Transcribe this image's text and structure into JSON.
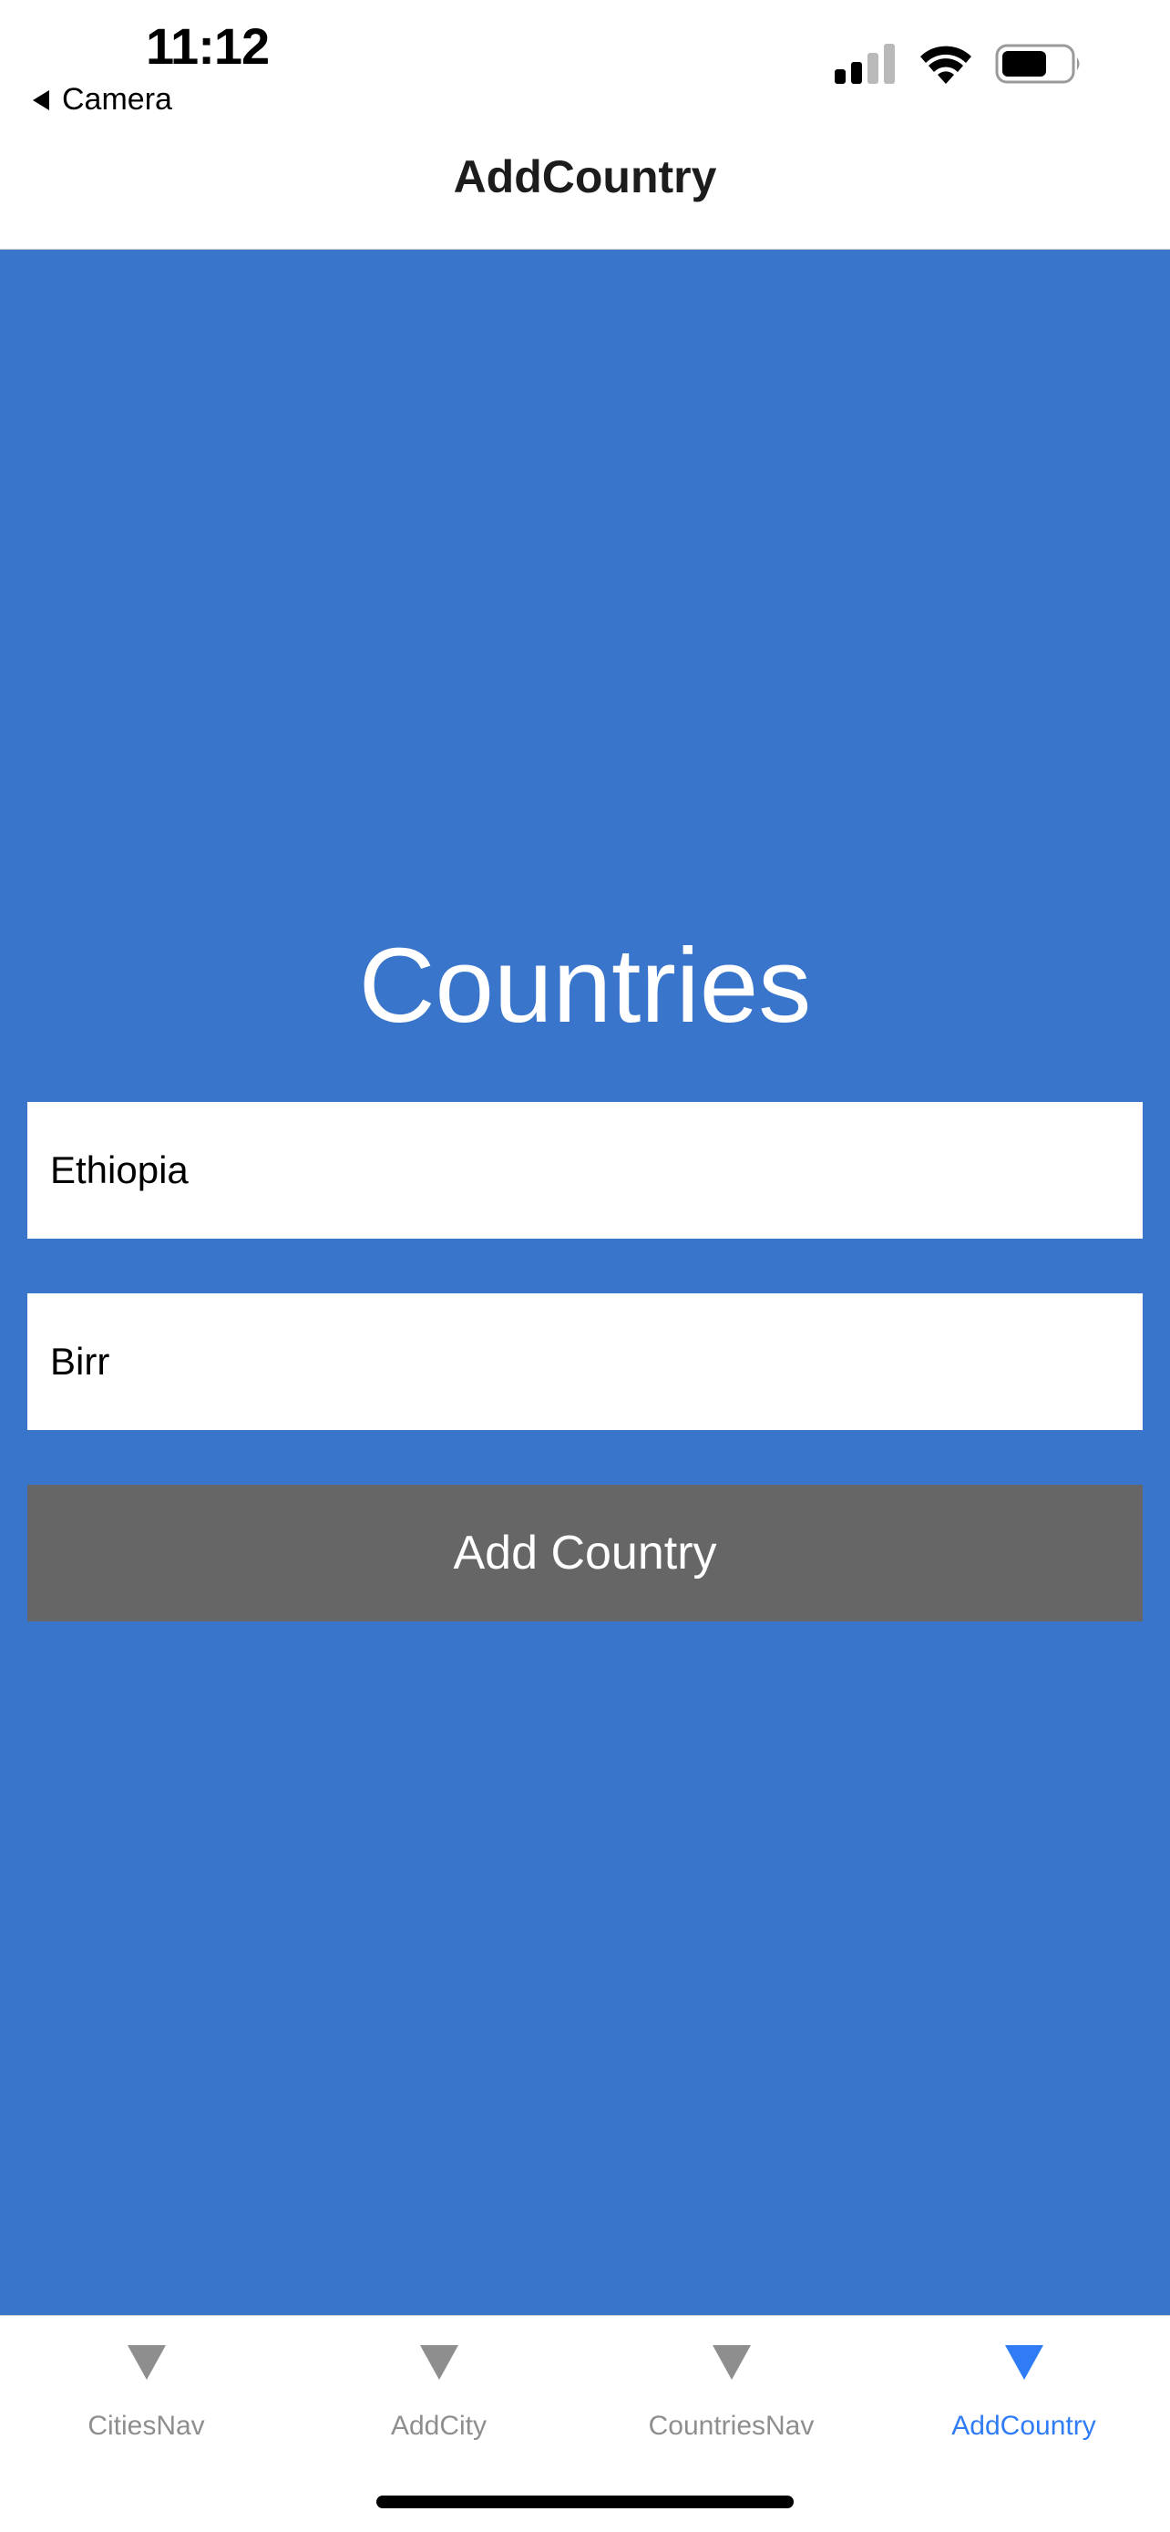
{
  "status_bar": {
    "time": "11:12",
    "back_label": "Camera",
    "icons": [
      "signal-icon",
      "wifi-icon",
      "battery-icon"
    ]
  },
  "nav": {
    "title": "AddCountry"
  },
  "main": {
    "heading": "Countries",
    "country_field": {
      "value": "Ethiopia"
    },
    "currency_field": {
      "value": "Birr"
    },
    "add_button_label": "Add Country"
  },
  "tabs": [
    {
      "label": "CitiesNav",
      "icon": "triangle-down-icon",
      "active": false
    },
    {
      "label": "AddCity",
      "icon": "triangle-down-icon",
      "active": false
    },
    {
      "label": "CountriesNav",
      "icon": "triangle-down-icon",
      "active": false
    },
    {
      "label": "AddCountry",
      "icon": "triangle-down-icon",
      "active": true
    }
  ],
  "colors": {
    "background": "#3a75cc",
    "button": "#666666",
    "active_tab": "#2f7cf6",
    "inactive_tab": "#8e8e8e"
  }
}
